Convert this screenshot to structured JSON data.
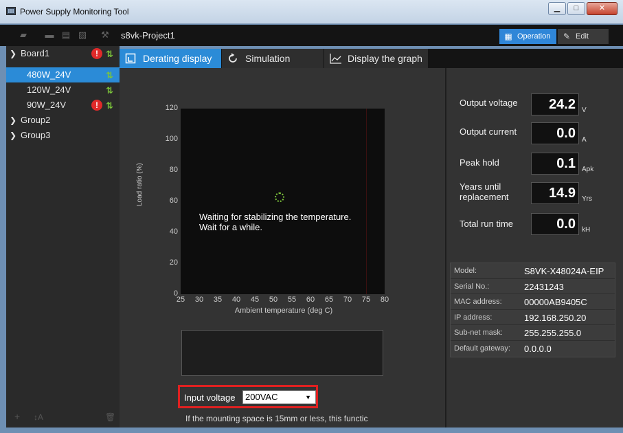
{
  "window": {
    "title": "Power Supply Monitoring Tool",
    "controls": [
      "minimize",
      "maximize",
      "close"
    ]
  },
  "toolbar": {
    "project_name": "s8vk-Project1",
    "icons": [
      "add-device-icon",
      "folder-icon",
      "save-icon",
      "edit-list-icon",
      "wrench-icon"
    ],
    "operation_label": "Operation",
    "edit_label": "Edit"
  },
  "sidebar": {
    "items": [
      {
        "label": "Board1",
        "alert": true,
        "sync": true
      },
      {
        "label": "480W_24V",
        "selected": true,
        "sync": true
      },
      {
        "label": "120W_24V",
        "sync": true
      },
      {
        "label": "90W_24V",
        "alert": true,
        "sync": true
      },
      {
        "label": "Group2"
      },
      {
        "label": "Group3"
      }
    ],
    "footer": {
      "add": "+",
      "sort": "↕A",
      "delete": "🗑"
    }
  },
  "tabs": [
    {
      "label": "Derating display",
      "active": true
    },
    {
      "label": "Simulation"
    },
    {
      "label": "Display the graph"
    }
  ],
  "chart_data": {
    "type": "line",
    "xlabel": "Ambient temperature (deg C)",
    "ylabel": "Load ratio (%)",
    "x_ticks": [
      "25",
      "30",
      "35",
      "40",
      "45",
      "50",
      "55",
      "60",
      "65",
      "70",
      "75",
      "80"
    ],
    "y_ticks": [
      "0",
      "20",
      "40",
      "60",
      "80",
      "100",
      "120"
    ],
    "xlim": [
      25,
      80
    ],
    "ylim": [
      0,
      120
    ],
    "series": [],
    "status_message": "Waiting for stabilizing the temperature.\nWait for a while."
  },
  "input_voltage": {
    "label": "Input voltage",
    "value": "200VAC"
  },
  "footnote": "If the mounting space is 15mm or less, this functic",
  "readings": [
    {
      "label": "Output voltage",
      "value": "24.2",
      "unit": "V"
    },
    {
      "label": "Output current",
      "value": "0.0",
      "unit": "A"
    },
    {
      "label": "Peak hold",
      "value": "0.1",
      "unit": "Apk"
    },
    {
      "label": "Years until\nreplacement",
      "value": "14.9",
      "unit": "Yrs"
    },
    {
      "label": "Total run time",
      "value": "0.0",
      "unit": "kH"
    }
  ],
  "device_info": [
    {
      "key": "Model:",
      "value": "S8VK-X48024A-EIP"
    },
    {
      "key": "Serial No.:",
      "value": "22431243"
    },
    {
      "key": "MAC address:",
      "value": "00000AB9405C"
    },
    {
      "key": "IP address:",
      "value": "192.168.250.20"
    },
    {
      "key": "Sub-net mask:",
      "value": "255.255.255.0"
    },
    {
      "key": "Default gateway:",
      "value": "0.0.0.0"
    }
  ]
}
